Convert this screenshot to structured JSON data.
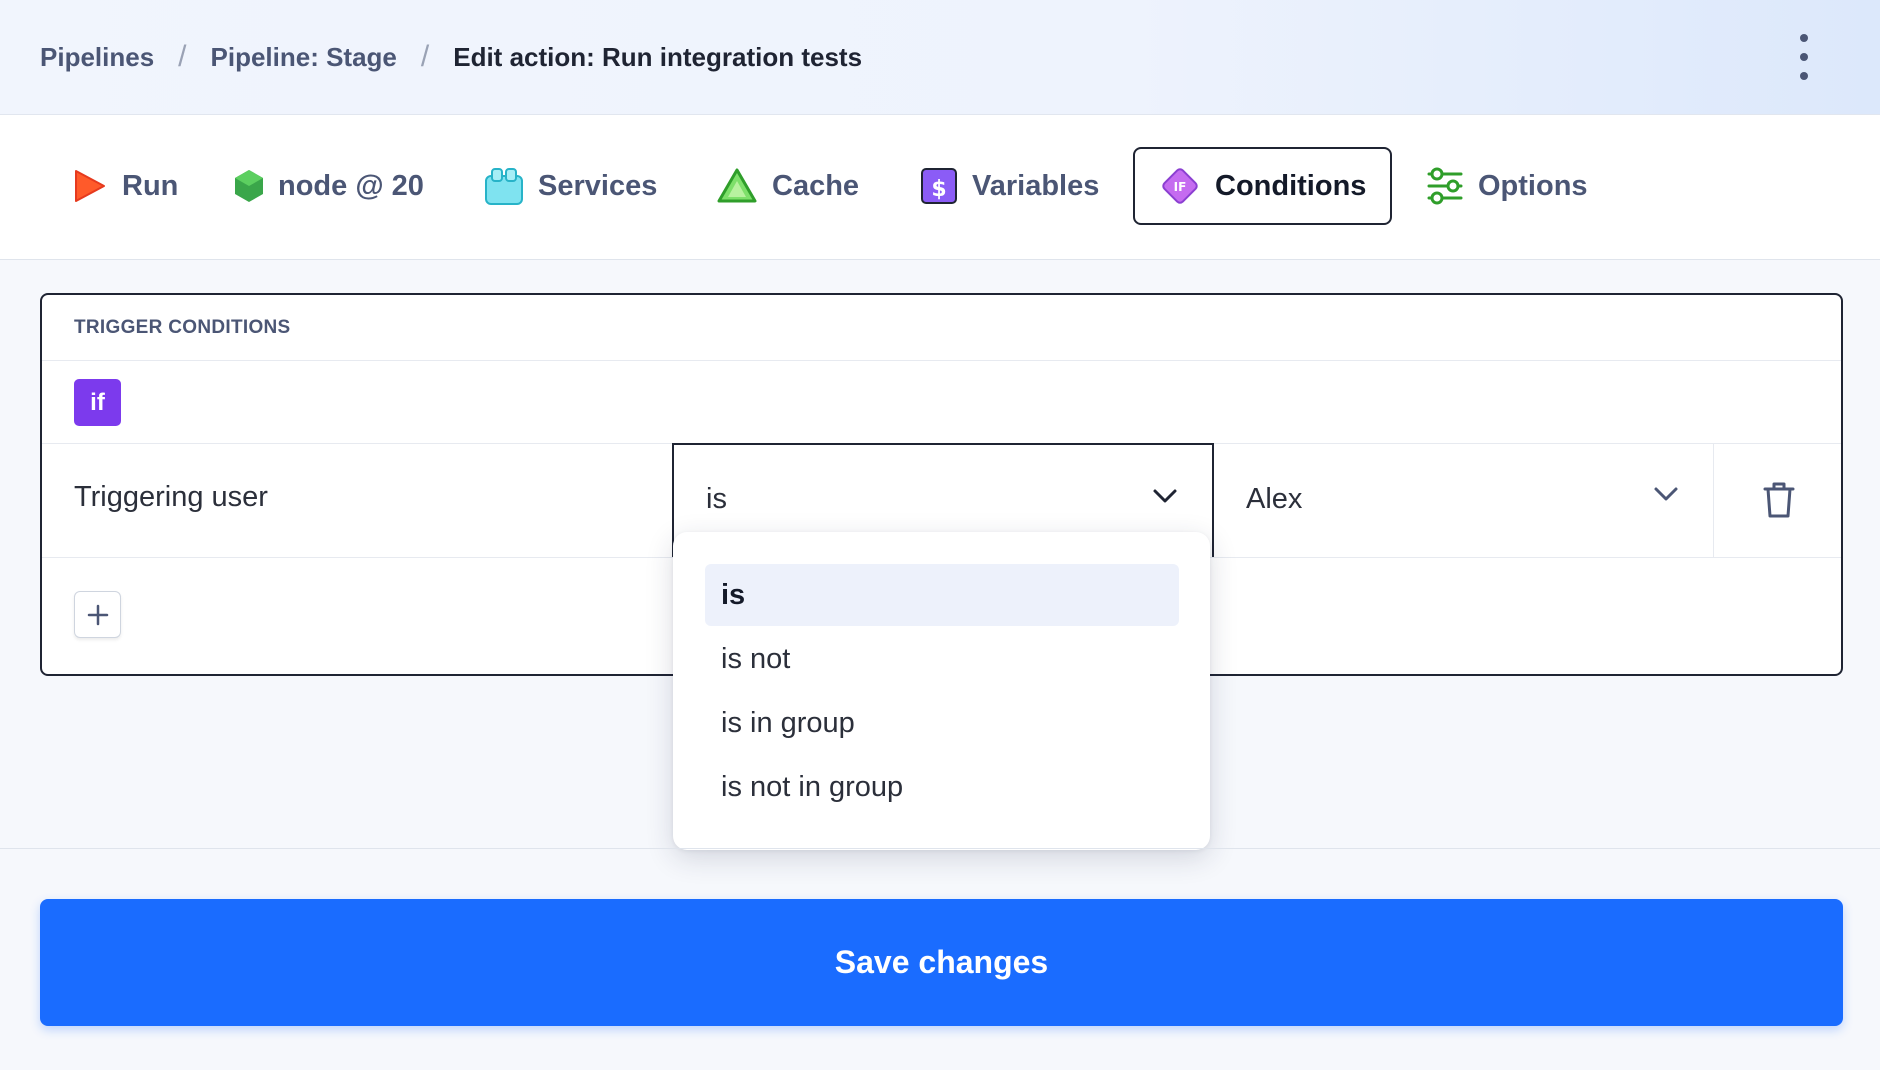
{
  "breadcrumb": {
    "items": [
      "Pipelines",
      "Pipeline: Stage"
    ],
    "current": "Edit action: Run integration tests",
    "separator": "/"
  },
  "tabs": [
    {
      "label": "Run",
      "icon": "play-icon"
    },
    {
      "label": "node @ 20",
      "icon": "nodejs-icon"
    },
    {
      "label": "Services",
      "icon": "services-icon"
    },
    {
      "label": "Cache",
      "icon": "cache-icon"
    },
    {
      "label": "Variables",
      "icon": "dollar-icon"
    },
    {
      "label": "Conditions",
      "icon": "if-diamond-icon",
      "active": true
    },
    {
      "label": "Options",
      "icon": "sliders-icon"
    }
  ],
  "conditions": {
    "title": "TRIGGER CONDITIONS",
    "badge": "if",
    "rows": [
      {
        "field": "Triggering user",
        "operator": "is",
        "value": "Alex"
      }
    ]
  },
  "dropdown": {
    "options": [
      "is",
      "is not",
      "is in group",
      "is not in group"
    ],
    "selected": "is"
  },
  "save_label": "Save changes",
  "colors": {
    "primary": "#1a6cff",
    "badge": "#7c3aed",
    "text": "#1f2433",
    "muted": "#4b5675"
  }
}
